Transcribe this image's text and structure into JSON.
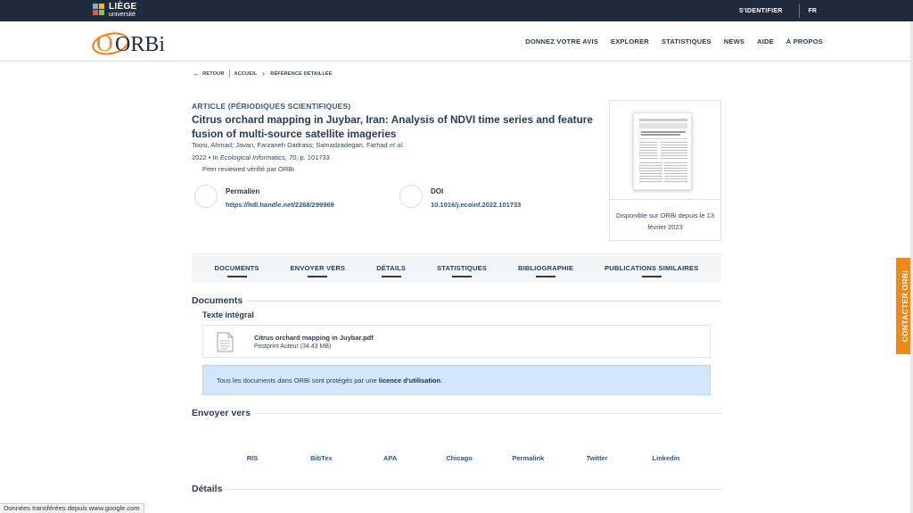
{
  "topbar": {
    "brand_line1": "LIÈGE",
    "brand_line2": "université",
    "login_label": "S'IDENTIFIER",
    "lang_label": "FR"
  },
  "header": {
    "logo_text": "ORBi",
    "nav": [
      "DONNEZ VOTRE AVIS",
      "EXPLORER",
      "STATISTIQUES",
      "NEWS",
      "AIDE",
      "À PROPOS"
    ]
  },
  "breadcrumb": {
    "back": "RETOUR",
    "home": "ACCUEIL",
    "current": "RÉFÉRENCE DÉTAILLÉE"
  },
  "article": {
    "type": "ARTICLE (PÉRIODIQUES SCIENTIFIQUES)",
    "title": "Citrus orchard mapping in Juybar, Iran: Analysis of NDVI time series and feature fusion of multi-source satellite imageries",
    "authors": "Toosi, Ahmad; Javan, Farzaneh Dadrass; Samadzadegan, Farhad",
    "authors_etal": "et al.",
    "ref_prefix": "2022 • In ",
    "ref_journal": "Ecological Informatics, 70",
    "ref_suffix": ", p. 101733",
    "peer": "Peer reviewed vérifié par ORBi",
    "permalink_label": "Permalien",
    "permalink_value": "https://hdl.handle.net/2268/299969",
    "doi_label": "DOI",
    "doi_value": "10.1016/j.ecoinf.2022.101733",
    "availability": "Disponible sur ORBi depuis le 13 février 2023"
  },
  "tabs": [
    "DOCUMENTS",
    "ENVOYER VERS",
    "DÉTAILS",
    "STATISTIQUES",
    "BIBLIOGRAPHIE",
    "PUBLICATIONS SIMILAIRES"
  ],
  "documents": {
    "title": "Documents",
    "subtitle": "Texte intégral",
    "file_name": "Citrus orchard mapping in Juybar.pdf",
    "file_desc": "Postprint Auteur (34.43 MB)",
    "notice_text": "Tous les documents dans ORBi sont protégés par une ",
    "notice_link": "licence d'utilisation",
    "notice_end": "."
  },
  "send_to": {
    "title": "Envoyer vers",
    "targets": [
      "RIS",
      "BibTex",
      "APA",
      "Chicago",
      "Permalink",
      "Twitter",
      "Linkedin"
    ]
  },
  "details": {
    "title": "Détails"
  },
  "contact_label": "CONTACTER ORBi",
  "status_text": "Données transférées depuis www.google.com",
  "colors": {
    "topbar": "#1f2b3c",
    "orbi_orange": "#f0871a",
    "notice_bg": "#d2e7f9",
    "link": "#2f5785"
  }
}
